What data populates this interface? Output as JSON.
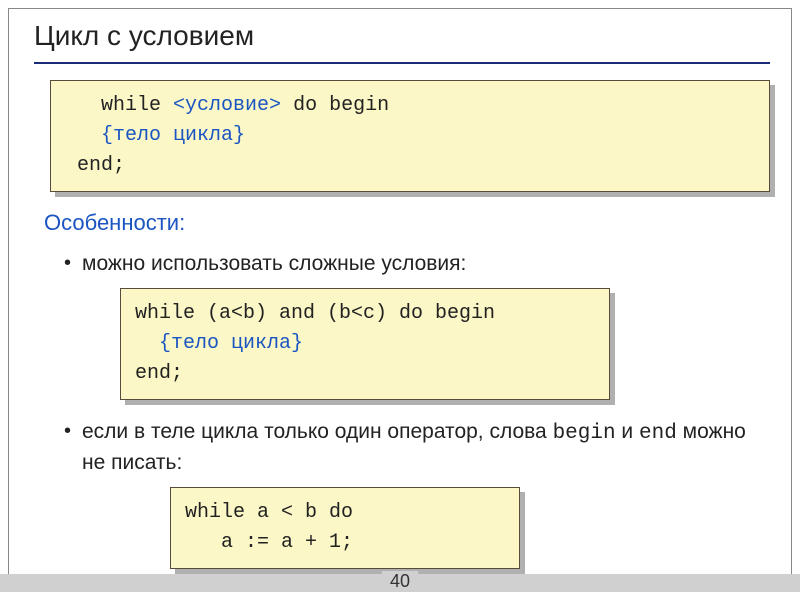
{
  "title": "Цикл с условием",
  "syntaxBox": {
    "line1_indent": "   ",
    "line1_a": "while ",
    "line1_tag": "<условие>",
    "line1_b": " do begin",
    "line2_indent": "   ",
    "line2_brace": "{тело цикла}",
    "line3": " end;"
  },
  "subhead": "Особенности:",
  "bullet1": "можно использовать сложные условия:",
  "codeBox2": {
    "line1": "while (a<b) and (b<c) do begin",
    "line2_indent": "  ",
    "line2_brace": "{тело цикла}",
    "line3": "end;"
  },
  "bullet2_a": "если в теле цикла только один оператор, слова ",
  "bullet2_mono1": "begin",
  "bullet2_b": " и ",
  "bullet2_mono2": "end",
  "bullet2_c": " можно не писать:",
  "codeBox3": {
    "line1": "while a < b do",
    "line2": "   a := a + 1;"
  },
  "pageNumber": "40"
}
